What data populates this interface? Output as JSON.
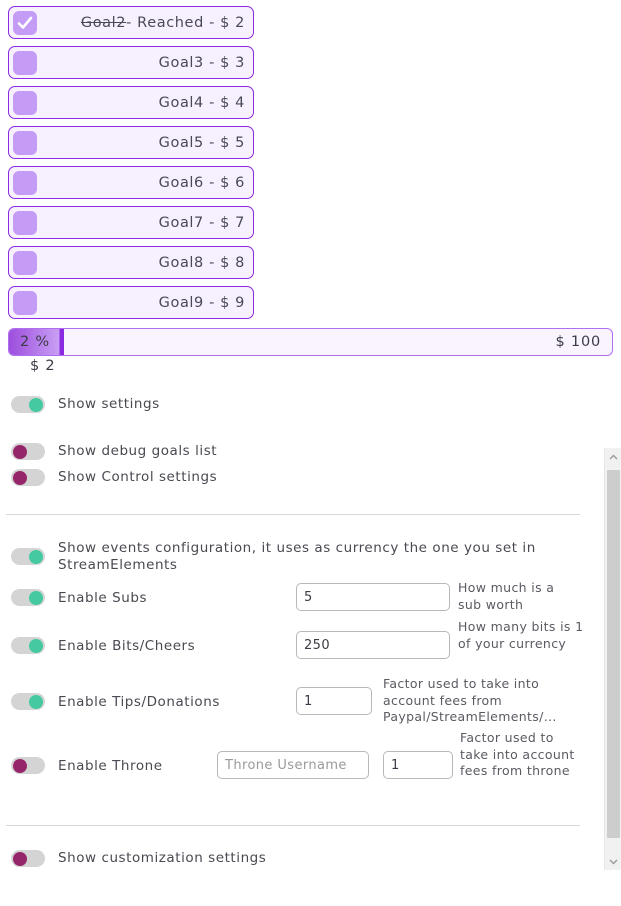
{
  "goals": {
    "items": [
      {
        "checked": true,
        "struck_text": "Goal2",
        "rest_text": "- Reached - $ 2"
      },
      {
        "checked": false,
        "struck_text": "",
        "rest_text": "Goal3 - $ 3"
      },
      {
        "checked": false,
        "struck_text": "",
        "rest_text": "Goal4 - $ 4"
      },
      {
        "checked": false,
        "struck_text": "",
        "rest_text": "Goal5 - $ 5"
      },
      {
        "checked": false,
        "struck_text": "",
        "rest_text": "Goal6 - $ 6"
      },
      {
        "checked": false,
        "struck_text": "",
        "rest_text": "Goal7 - $ 7"
      },
      {
        "checked": false,
        "struck_text": "",
        "rest_text": "Goal8 - $ 8"
      },
      {
        "checked": false,
        "struck_text": "",
        "rest_text": "Goal9 - $ 9"
      }
    ]
  },
  "progress": {
    "percent_label": "2 %",
    "max_label": "$ 100",
    "current_label": "$ 2",
    "fill_percent": 9.2,
    "accent_color": "#8a2be2",
    "track_color": "#faf4ff"
  },
  "toggles": {
    "show_settings": {
      "label": "Show settings",
      "on": true
    },
    "show_debug_goals_list": {
      "label": "Show debug goals list",
      "on": false
    },
    "show_control_settings": {
      "label": "Show Control settings",
      "on": false
    },
    "show_events_configuration": {
      "label": "Show events configuration, it uses as currency the one you set in StreamElements",
      "on": true
    },
    "show_customization_settings": {
      "label": "Show customization settings",
      "on": false
    }
  },
  "events": [
    {
      "name": "Enable Subs",
      "on": true,
      "value": "5",
      "placeholder": "",
      "hint": "How much is a sub worth"
    },
    {
      "name": "Enable Bits/Cheers",
      "on": true,
      "value": "250",
      "placeholder": "",
      "hint": "How many bits is 1 of your currency"
    },
    {
      "name": "Enable Tips/Donations",
      "on": true,
      "value": "1",
      "placeholder": "",
      "hint": "Factor used to take into account fees from Paypal/StreamElements/..."
    },
    {
      "name": "Enable Throne",
      "on": false,
      "username_value": "",
      "username_placeholder": "Throne Username",
      "value": "1",
      "hint": "Factor used to take into account fees from throne"
    }
  ],
  "scrollbar": {
    "up_icon": "chevron-up-icon",
    "down_icon": "chevron-down-icon"
  },
  "colors": {
    "goal_border": "#8a2be2",
    "goal_bg": "#f7f0ff",
    "checkbox": "#c49bf5",
    "toggle_on": "#45c9a0",
    "toggle_off": "#96266a"
  }
}
